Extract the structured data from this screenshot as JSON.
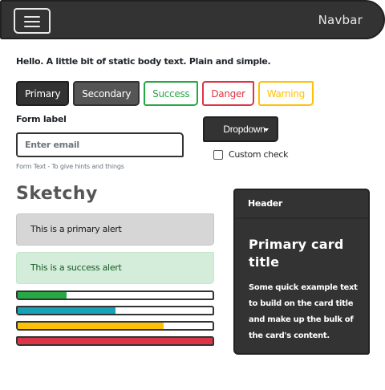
{
  "navbar": {
    "brand": "Navbar",
    "toggler_icon": "hamburger-menu-icon"
  },
  "body_text": "Hello. A little bit of static body text. Plain and simple.",
  "buttons": {
    "primary": "Primary",
    "secondary": "Secondary",
    "success": "Success",
    "danger": "Danger",
    "warning": "Warning"
  },
  "form": {
    "label": "Form label",
    "email_placeholder": "Enter email",
    "email_value": "",
    "help_text": "Form Text - To give hints and things"
  },
  "dropdown": {
    "label": "Dropdown",
    "caret_icon": "caret-down-icon"
  },
  "custom_check": {
    "label": "Custom check",
    "checked": false
  },
  "heading": "Sketchy",
  "alerts": {
    "primary": "This is a primary alert",
    "success": "This is a success alert"
  },
  "progress_bars": [
    {
      "value": 0.25,
      "color": "#28a745"
    },
    {
      "value": 0.5,
      "color": "#17a2b8"
    },
    {
      "value": 0.75,
      "color": "#ffc107"
    },
    {
      "value": 1.0,
      "color": "#dc3545"
    }
  ],
  "card": {
    "header": "Header",
    "title": "Primary card title",
    "text": "Some quick example text to build on the card title and make up the bulk of the card's content."
  },
  "colors": {
    "dark": "#333333",
    "secondary": "#555555",
    "success": "#28a745",
    "info": "#17a2b8",
    "warning": "#ffc107",
    "danger": "#dc3545"
  }
}
